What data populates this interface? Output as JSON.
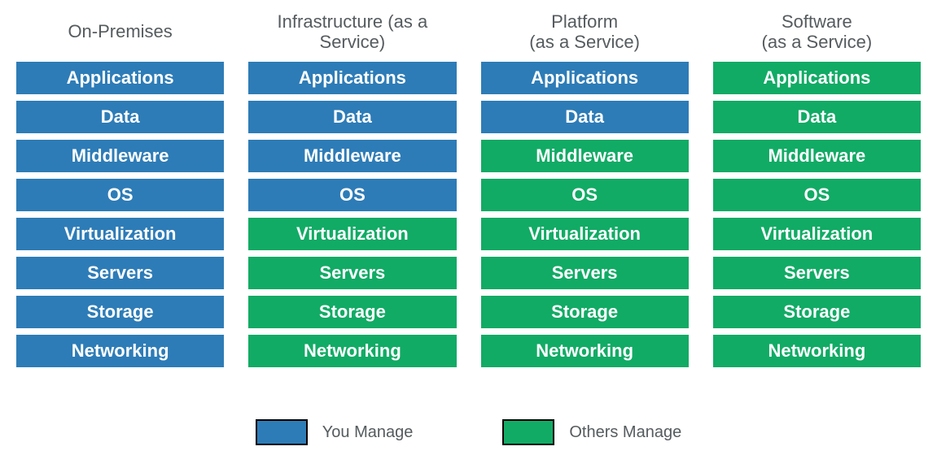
{
  "colors": {
    "you": "#2d7cb7",
    "others": "#11ab65"
  },
  "layers": [
    "Applications",
    "Data",
    "Middleware",
    "OS",
    "Virtualization",
    "Servers",
    "Storage",
    "Networking"
  ],
  "columns": [
    {
      "title": "On-Premises",
      "managed_by": [
        "you",
        "you",
        "you",
        "you",
        "you",
        "you",
        "you",
        "you"
      ]
    },
    {
      "title": "Infrastructure (as a\nService)",
      "managed_by": [
        "you",
        "you",
        "you",
        "you",
        "others",
        "others",
        "others",
        "others"
      ]
    },
    {
      "title": "Platform\n(as a Service)",
      "managed_by": [
        "you",
        "you",
        "others",
        "others",
        "others",
        "others",
        "others",
        "others"
      ]
    },
    {
      "title": "Software\n(as a Service)",
      "managed_by": [
        "others",
        "others",
        "others",
        "others",
        "others",
        "others",
        "others",
        "others"
      ]
    }
  ],
  "legend": [
    {
      "key": "you",
      "label": "You Manage"
    },
    {
      "key": "others",
      "label": "Others Manage"
    }
  ]
}
